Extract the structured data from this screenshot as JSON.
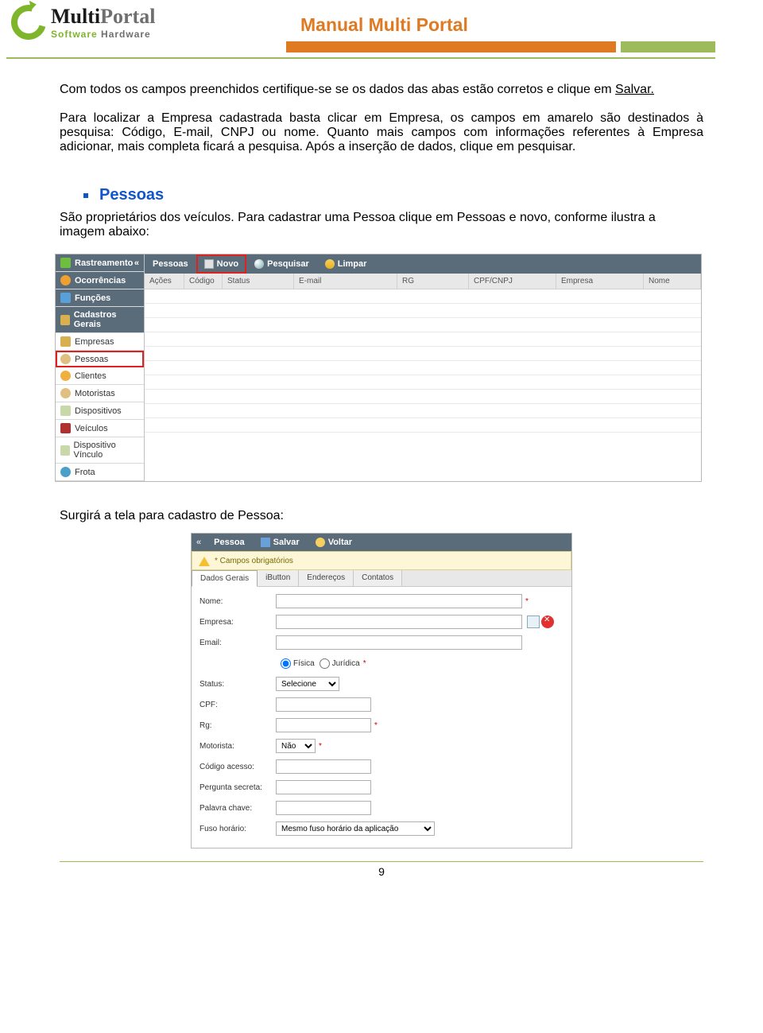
{
  "header": {
    "title": "Manual Multi Portal",
    "logo_multi": "Multi",
    "logo_portal": "Portal",
    "logo_sw": "Software",
    "logo_hw": "Hardware"
  },
  "content": {
    "para1_a": "Com todos os campos preenchidos certifique-se se os dados das abas estão corretos e clique em ",
    "para1_link": "Salvar.",
    "para2": "Para localizar a Empresa cadastrada basta clicar em Empresa, os campos em amarelo são destinados à pesquisa: Código, E-mail, CNPJ ou nome. Quanto mais campos com informações referentes à Empresa adicionar, mais completa ficará a pesquisa. Após a inserção de dados, clique em pesquisar.",
    "bullet_heading": "Pessoas",
    "para3": "São proprietários dos veículos. Para cadastrar uma Pessoa clique em Pessoas e novo, conforme ilustra a imagem abaixo:",
    "caption2": "Surgirá a tela para cadastro de Pessoa:"
  },
  "ss1": {
    "side": {
      "rastreamento": "Rastreamento",
      "ocorrencias": "Ocorrências",
      "funcoes": "Funções",
      "cadastros": "Cadastros Gerais",
      "items": [
        "Empresas",
        "Pessoas",
        "Clientes",
        "Motoristas",
        "Dispositivos",
        "Veículos",
        "Dispositivo Vínculo",
        "Frota"
      ]
    },
    "toolbar": {
      "pessoas": "Pessoas",
      "novo": "Novo",
      "pesquisar": "Pesquisar",
      "limpar": "Limpar"
    },
    "columns": [
      "Ações",
      "Código",
      "Status",
      "E-mail",
      "RG",
      "CPF/CNPJ",
      "Empresa",
      "Nome"
    ]
  },
  "ss2": {
    "toolbar": {
      "pessoa": "Pessoa",
      "salvar": "Salvar",
      "voltar": "Voltar"
    },
    "req": "* Campos obrigatórios",
    "tabs": [
      "Dados Gerais",
      "iButton",
      "Endereços",
      "Contatos"
    ],
    "labels": {
      "nome": "Nome:",
      "empresa": "Empresa:",
      "email": "Email:",
      "fisica": "Física",
      "juridica": "Jurídica",
      "status": "Status:",
      "status_opt": "Selecione",
      "cpf": "CPF:",
      "rg": "Rg:",
      "motorista": "Motorista:",
      "motorista_opt": "Não",
      "codigo": "Código acesso:",
      "pergunta": "Pergunta secreta:",
      "palavra": "Palavra chave:",
      "fuso": "Fuso horário:",
      "fuso_opt": "Mesmo fuso horário da aplicação"
    }
  },
  "pagenum": "9"
}
